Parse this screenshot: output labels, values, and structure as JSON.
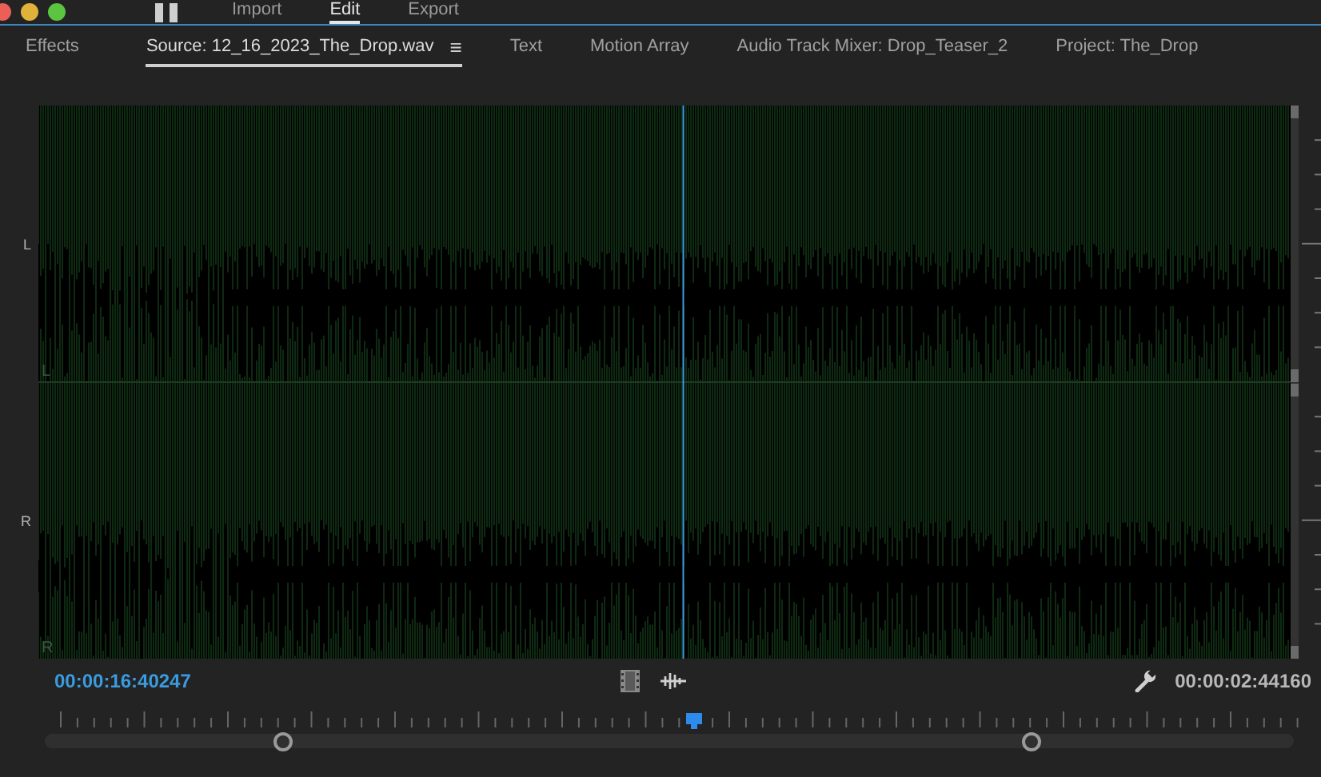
{
  "workspaces": [
    {
      "label": "Import",
      "selected": false
    },
    {
      "label": "Edit",
      "selected": true
    },
    {
      "label": "Export",
      "selected": false
    }
  ],
  "panel_tabs": [
    {
      "label": "Effects",
      "selected": false
    },
    {
      "label": "Source: 12_16_2023_The_Drop.wav",
      "selected": true,
      "menu_glyph": "≡"
    },
    {
      "label": "Text",
      "selected": false
    },
    {
      "label": "Motion Array",
      "selected": false
    },
    {
      "label": "Audio Track Mixer: Drop_Teaser_2",
      "selected": false
    },
    {
      "label": "Project: The_Drop",
      "selected": false
    }
  ],
  "channels": [
    {
      "label": "L",
      "inner_label": "L"
    },
    {
      "label": "R",
      "inner_label": "R"
    }
  ],
  "current_time": "00:00:16:40247",
  "duration": "00:00:02:44160"
}
